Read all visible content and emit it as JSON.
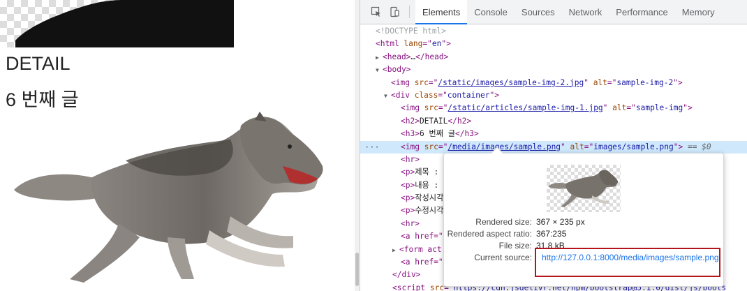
{
  "page": {
    "heading": "DETAIL",
    "subheading": "6 번째 글"
  },
  "devtools": {
    "tabs": [
      {
        "label": "Elements",
        "active": true
      },
      {
        "label": "Console"
      },
      {
        "label": "Sources"
      },
      {
        "label": "Network"
      },
      {
        "label": "Performance"
      },
      {
        "label": "Memory"
      }
    ],
    "dom": {
      "doctype": "<!DOCTYPE html>",
      "html_lang": "en",
      "head_collapsed": "…",
      "img1_src": "/static/images/sample-img-2.jpg",
      "img1_alt": "sample-img-2",
      "div_class": "container",
      "img2_src": "/static/articles/sample-img-1.jpg",
      "img2_alt": "sample-img",
      "h2_text": "DETAIL",
      "h3_text": "6 번째 글",
      "img3_src": "/media/images/sample.png",
      "img3_alt": "images/sample.png",
      "selected_marker": "== $0",
      "p1": "제목 :",
      "p2": "내용 :",
      "p3": "작성시각",
      "p4": "수정시각",
      "a_href": "a href=\"",
      "form_prefix": "form act",
      "script_src": "https://cdn.jsdelivr.net/npm/bootstrap@5.1.0/dist/js/boots"
    },
    "tooltip": {
      "rendered_size_label": "Rendered size:",
      "rendered_size": "367 × 235 px",
      "aspect_label": "Rendered aspect ratio:",
      "aspect": "367:235",
      "file_size_label": "File size:",
      "file_size": "31.8 kB",
      "source_label": "Current source:",
      "source_url": "http://127.0.0.1:8000/media/images/sample.png"
    }
  },
  "colors": {
    "tag": "#881280",
    "attr": "#994500",
    "value": "#1a1aa6",
    "highlight": "#b5121b",
    "selection": "#cfe8fc"
  }
}
